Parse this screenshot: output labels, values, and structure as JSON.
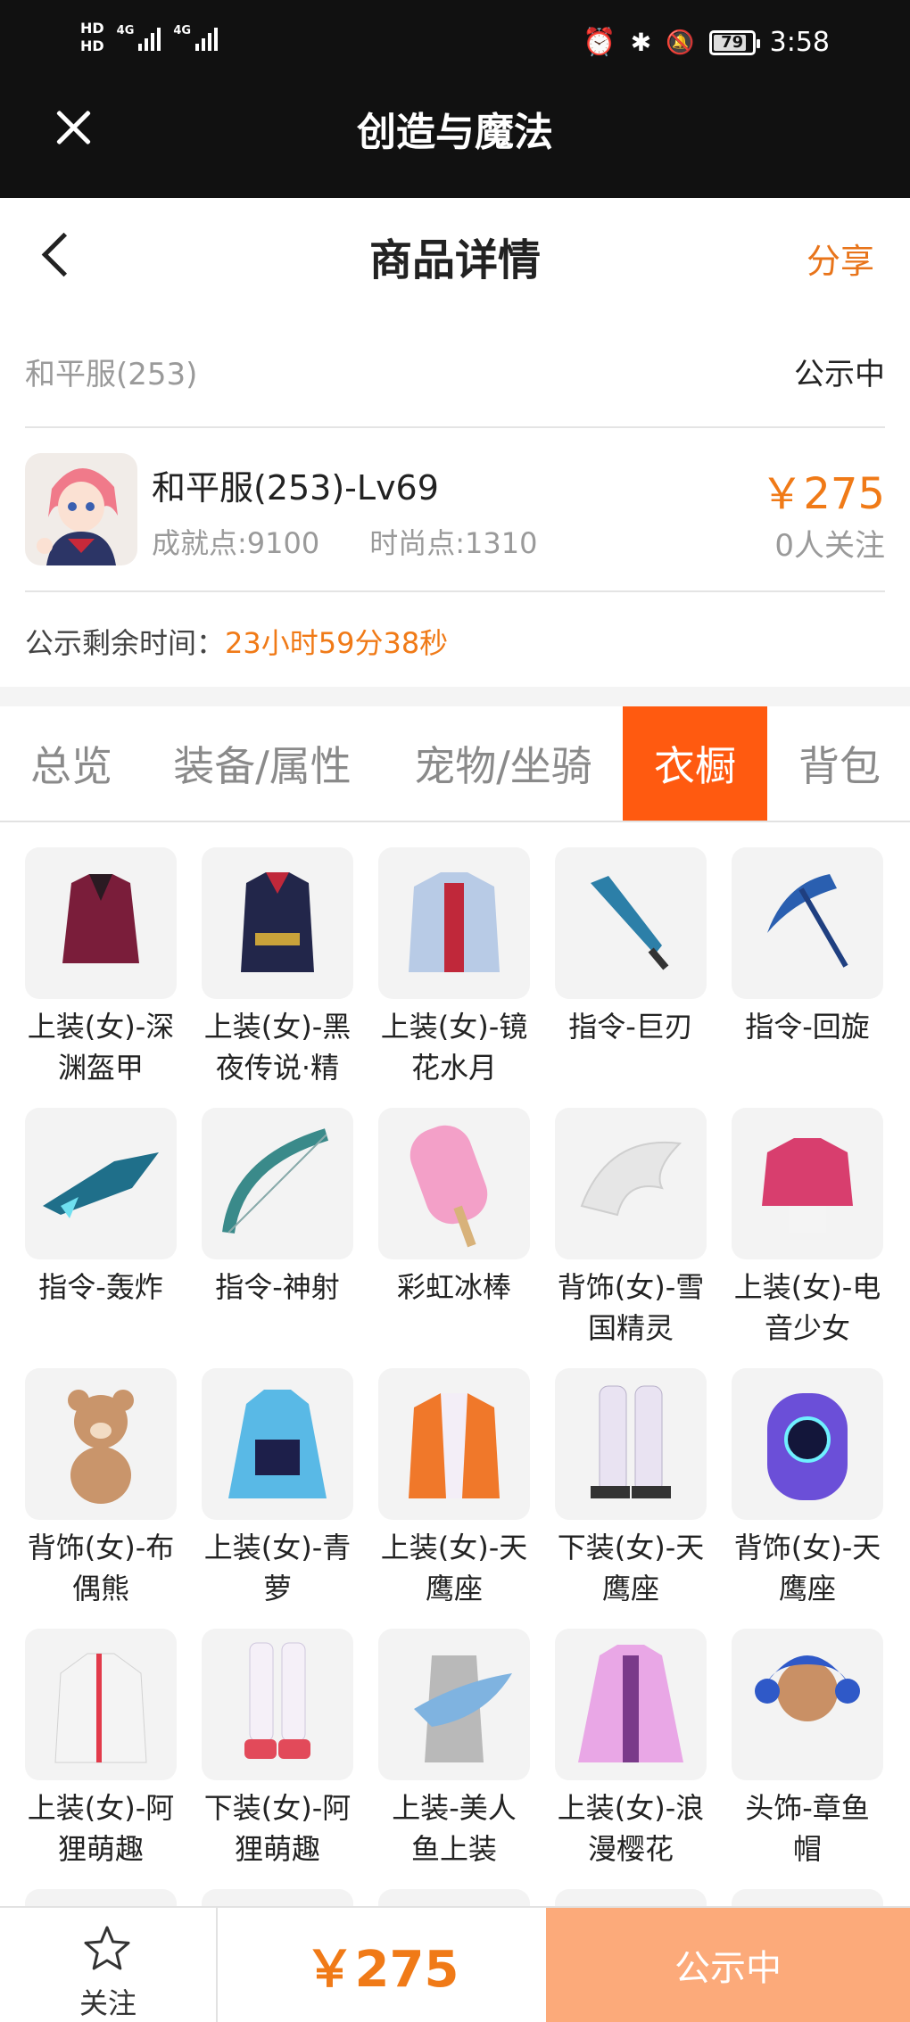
{
  "status_bar": {
    "hd1": "HD",
    "hd2": "HD",
    "signal1": "4G",
    "signal2": "4G",
    "battery": "79",
    "time": "3:58"
  },
  "app_bar": {
    "title": "创造与魔法"
  },
  "header": {
    "title": "商品详情",
    "share": "分享"
  },
  "server": {
    "name": "和平服(253)",
    "status": "公示中"
  },
  "product": {
    "name": "和平服(253)-Lv69",
    "achievement": "成就点:9100",
    "fashion": "时尚点:1310",
    "price": "￥275",
    "followers": "0人关注"
  },
  "remaining": {
    "label": "公示剩余时间：",
    "value": "23小时59分38秒"
  },
  "tabs": [
    {
      "label": "总览"
    },
    {
      "label": "装备/属性"
    },
    {
      "label": "宠物/坐骑"
    },
    {
      "label": "衣橱"
    },
    {
      "label": "背包"
    }
  ],
  "items": [
    {
      "line1": "上装(女)-深",
      "line2": "渊盔甲",
      "icon": "armor-top-icon",
      "color": "#7a1d3a"
    },
    {
      "line1": "上装(女)-黑",
      "line2": "夜传说·精",
      "icon": "coat-top-icon",
      "color": "#22264a"
    },
    {
      "line1": "上装(女)-镜",
      "line2": "花水月",
      "icon": "kimono-top-icon",
      "color": "#b8cbe6"
    },
    {
      "line1": "指令-巨刃",
      "line2": "",
      "icon": "blade-icon",
      "color": "#2c7fa8"
    },
    {
      "line1": "指令-回旋",
      "line2": "",
      "icon": "scythe-icon",
      "color": "#2a5fb0"
    },
    {
      "line1": "指令-轰炸",
      "line2": "",
      "icon": "jet-icon",
      "color": "#1f6f8a"
    },
    {
      "line1": "指令-神射",
      "line2": "",
      "icon": "bow-icon",
      "color": "#3a8a8a"
    },
    {
      "line1": "彩虹冰棒",
      "line2": "",
      "icon": "popsicle-icon",
      "color": "#f3a0c8"
    },
    {
      "line1": "背饰(女)-雪",
      "line2": "国精灵",
      "icon": "wings-icon",
      "color": "#e6e6e6"
    },
    {
      "line1": "上装(女)-电",
      "line2": "音少女",
      "icon": "jacket-top-icon",
      "color": "#d83e6e"
    },
    {
      "line1": "背饰(女)-布",
      "line2": "偶熊",
      "icon": "teddy-bear-icon",
      "color": "#c9956b"
    },
    {
      "line1": "上装(女)-青",
      "line2": "萝",
      "icon": "dress-top-icon",
      "color": "#59b9e6"
    },
    {
      "line1": "上装(女)-天",
      "line2": "鹰座",
      "icon": "suit-top-icon",
      "color": "#f0782a"
    },
    {
      "line1": "下装(女)-天",
      "line2": "鹰座",
      "icon": "boots-icon",
      "color": "#e9e3f2"
    },
    {
      "line1": "背饰(女)-天",
      "line2": "鹰座",
      "icon": "backpack-icon",
      "color": "#6b4fd8"
    },
    {
      "line1": "上装(女)-阿",
      "line2": "狸萌趣",
      "icon": "hoodie-top-icon",
      "color": "#f4f4f4"
    },
    {
      "line1": "下装(女)-阿",
      "line2": "狸萌趣",
      "icon": "stockings-icon",
      "color": "#f5f0f8"
    },
    {
      "line1": "上装-美人",
      "line2": "鱼上装",
      "icon": "mermaid-top-icon",
      "color": "#7fb3e0"
    },
    {
      "line1": "上装(女)-浪",
      "line2": "漫樱花",
      "icon": "sakura-dress-icon",
      "color": "#e9a7e6"
    },
    {
      "line1": "头饰-章鱼",
      "line2": "帽",
      "icon": "octopus-hat-icon",
      "color": "#2f59c8"
    }
  ],
  "bottom_bar": {
    "follow": "关注",
    "total": "￥275",
    "cta": "公示中"
  }
}
